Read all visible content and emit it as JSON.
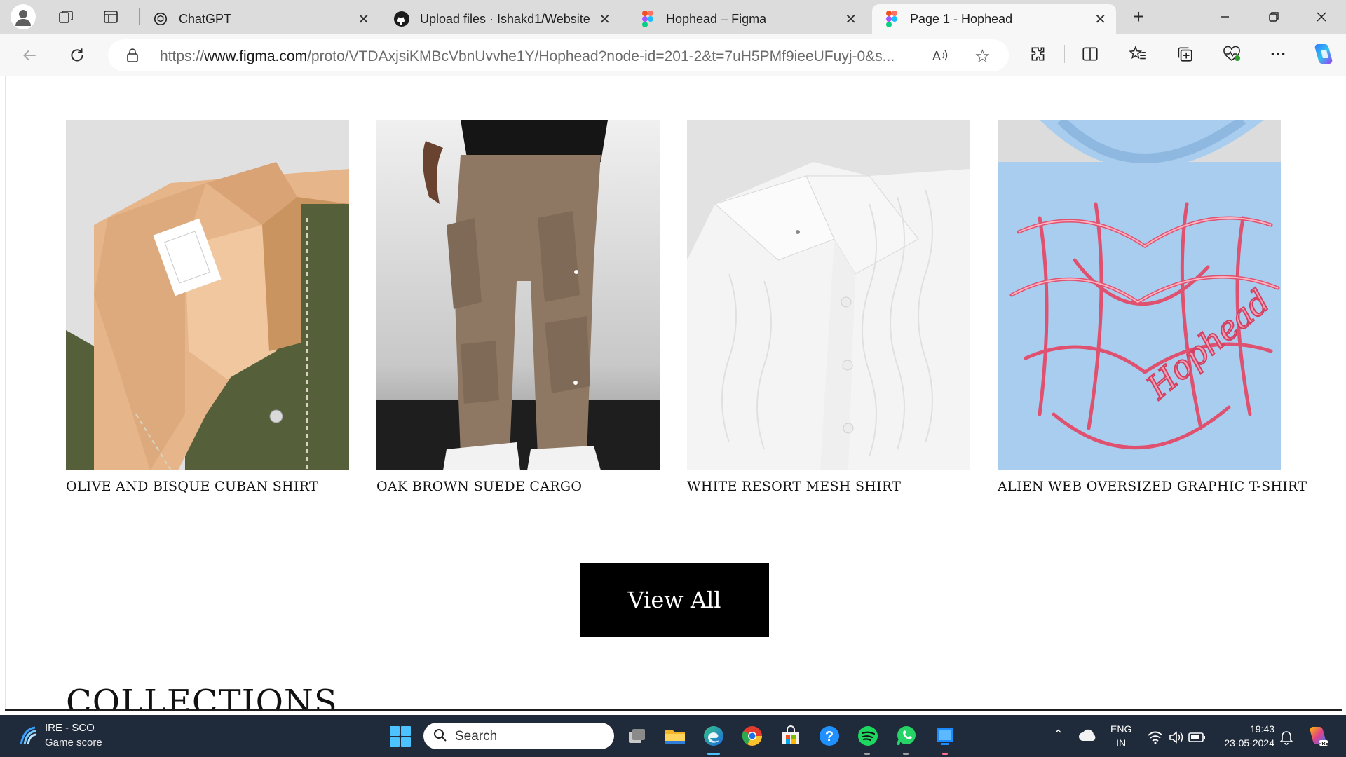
{
  "browser": {
    "tabs": [
      {
        "label": "ChatGPT",
        "icon": "chatgpt-icon",
        "active": false
      },
      {
        "label": "Upload files · Ishakd1/Website",
        "icon": "github-icon",
        "active": false
      },
      {
        "label": "Hophead – Figma",
        "icon": "figma-icon",
        "active": false
      },
      {
        "label": "Page 1 - Hophead",
        "icon": "figma-icon",
        "active": true
      }
    ],
    "new_tab_label": "+",
    "url_prefix": "https://",
    "url_host": "www.figma.com",
    "url_path": "/proto/VTDAxjsiKMBcVbnUvvhe1Y/Hophead?node-id=201-2&t=7uH5PMf9ieeUFuyj-0&s...",
    "read_aloud_label": "A͡ʾ"
  },
  "page": {
    "products": [
      {
        "name": "OLIVE AND BISQUE CUBAN SHIRT",
        "image": "olive-bisque-cuban-shirt"
      },
      {
        "name": "OAK BROWN SUEDE CARGO",
        "image": "oak-brown-suede-cargo"
      },
      {
        "name": "WHITE RESORT MESH SHIRT",
        "image": "white-resort-mesh-shirt"
      },
      {
        "name": "ALIEN WEB OVERSIZED GRAPHIC T-SHIRT",
        "image": "alien-web-graphic-tshirt"
      }
    ],
    "view_all_label": "View All",
    "section_heading": "COLLECTIONS"
  },
  "taskbar": {
    "weather_line1": "IRE - SCO",
    "weather_line2": "Game score",
    "search_placeholder": "Search",
    "lang_line1": "ENG",
    "lang_line2": "IN",
    "time": "19:43",
    "date": "23-05-2024",
    "accent": "#4cc2ff"
  }
}
